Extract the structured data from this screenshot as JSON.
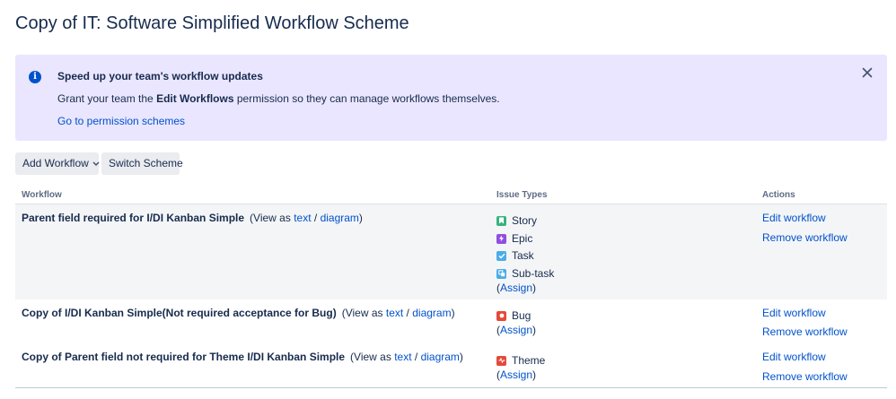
{
  "page": {
    "title": "Copy of IT: Software Simplified Workflow Scheme"
  },
  "banner": {
    "title": "Speed up your team's workflow updates",
    "body_prefix": "Grant your team the ",
    "body_bold": "Edit Workflows",
    "body_suffix": " permission so they can manage workflows themselves.",
    "link": "Go to permission schemes",
    "info_glyph": "i"
  },
  "toolbar": {
    "add_workflow": "Add Workflow",
    "switch_scheme": "Switch Scheme"
  },
  "table": {
    "headers": {
      "workflow": "Workflow",
      "issue_types": "Issue Types",
      "actions": "Actions"
    },
    "view_prefix": "(View as",
    "view_text": "text",
    "view_sep": "/",
    "view_diagram": "diagram",
    "view_suffix": ")",
    "assign_open": "(",
    "assign_link": "Assign",
    "assign_close": ")",
    "edit_label": "Edit workflow",
    "remove_label": "Remove workflow",
    "rows": [
      {
        "name": "Parent field required for I/DI Kanban Simple",
        "issue_types": [
          {
            "name": "Story",
            "icon": "story-icon",
            "color": "#36b37e"
          },
          {
            "name": "Epic",
            "icon": "epic-icon",
            "color": "#904ee2"
          },
          {
            "name": "Task",
            "icon": "task-icon",
            "color": "#4bade8"
          },
          {
            "name": "Sub-task",
            "icon": "subtask-icon",
            "color": "#4bade8"
          }
        ]
      },
      {
        "name": "Copy of I/DI Kanban Simple(Not required acceptance for Bug)",
        "issue_types": [
          {
            "name": "Bug",
            "icon": "bug-icon",
            "color": "#e5493a"
          }
        ]
      },
      {
        "name": "Copy of Parent field not required for Theme I/DI Kanban Simple",
        "issue_types": [
          {
            "name": "Theme",
            "icon": "theme-icon",
            "color": "#e5493a"
          }
        ]
      }
    ]
  },
  "colors": {
    "accent": "#0052cc",
    "banner_bg": "#eae6ff",
    "row_highlight": "#f4f5f7",
    "text": "#172b4d"
  }
}
